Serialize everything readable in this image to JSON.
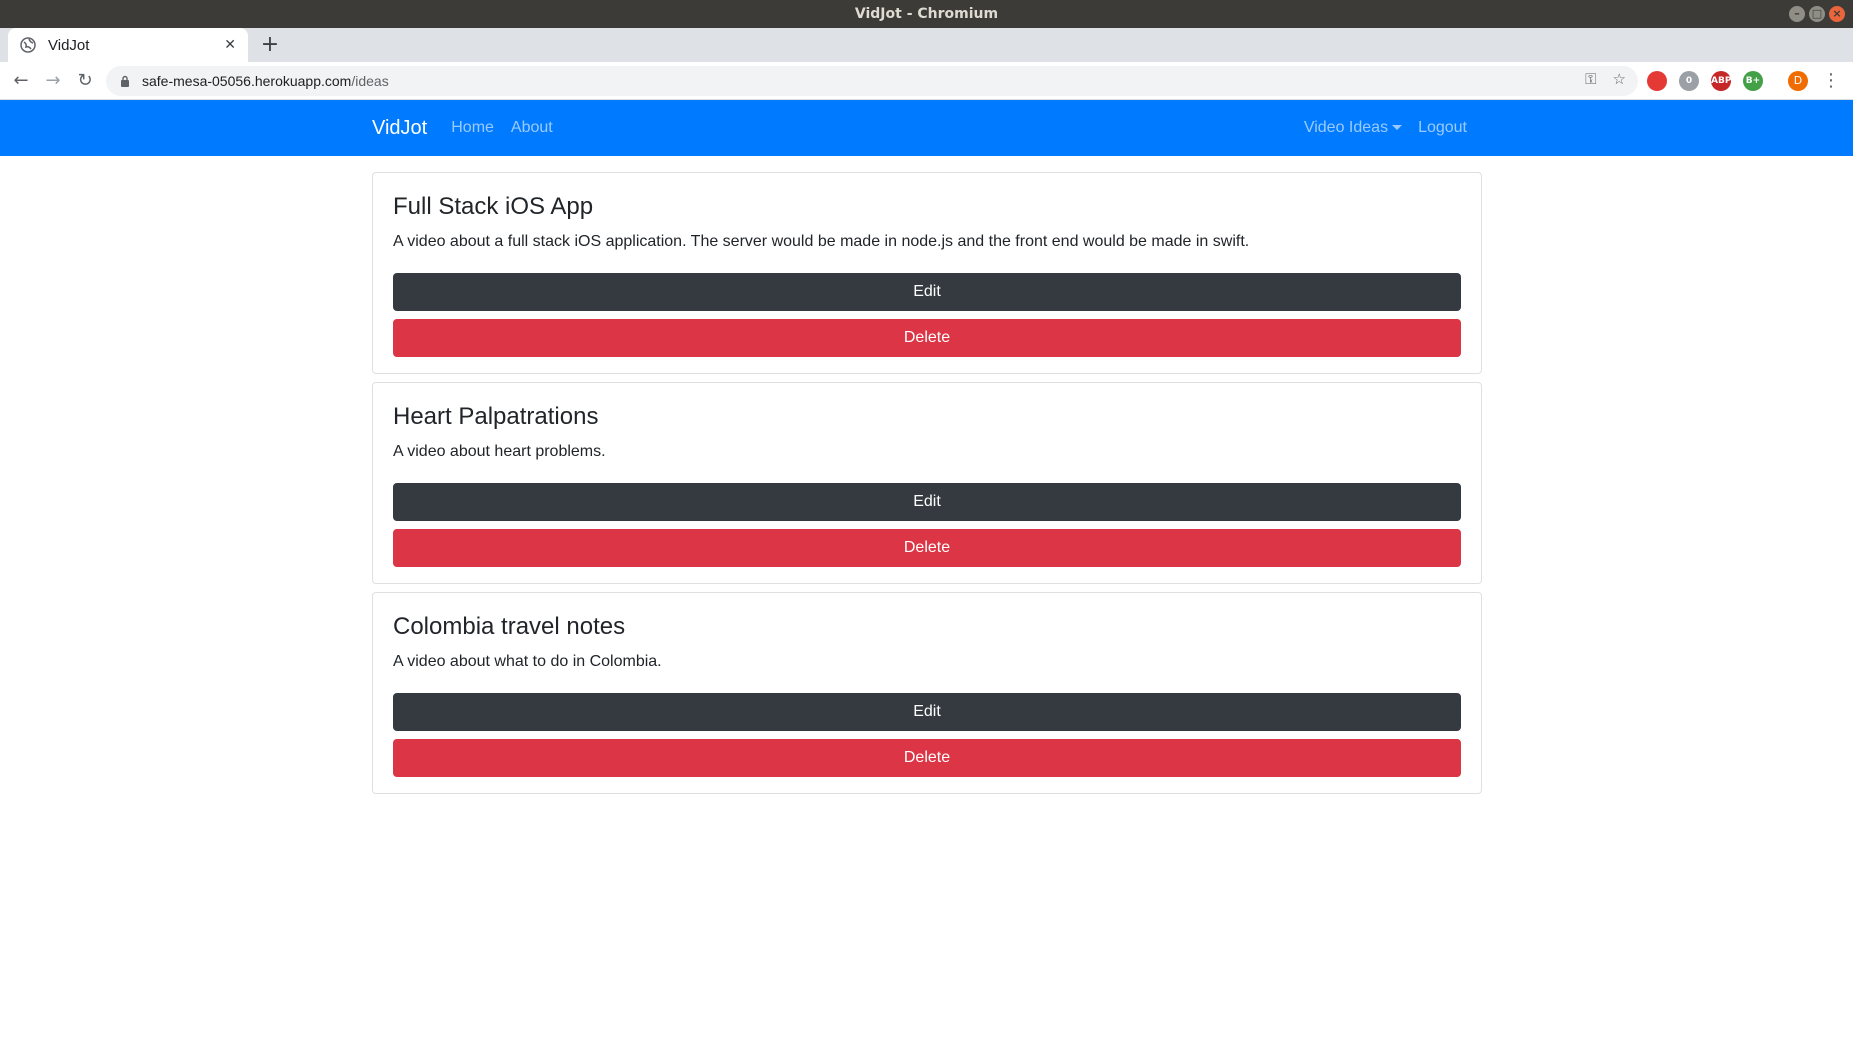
{
  "window": {
    "title": "VidJot - Chromium"
  },
  "browser": {
    "tab_title": "VidJot",
    "new_tab_label": "+",
    "url_host": "safe-mesa-05056.herokuapp.com",
    "url_path": "/ideas",
    "extensions": [
      {
        "name": "ublock-icon",
        "color": "#e53935",
        "label": ""
      },
      {
        "name": "privacy-extension-icon",
        "color": "#9aa0a6",
        "label": "0"
      },
      {
        "name": "adblock-plus-icon",
        "color": "#c62828",
        "label": "ABP"
      },
      {
        "name": "grammar-extension-icon",
        "color": "#43a047",
        "label": "B+"
      },
      {
        "name": "profile-avatar",
        "color": "#ef6c00",
        "label": "D"
      }
    ]
  },
  "navbar": {
    "brand": "VidJot",
    "links": [
      "Home",
      "About"
    ],
    "dropdown_label": "Video Ideas",
    "logout_label": "Logout",
    "background_color": "#007bff"
  },
  "ideas": [
    {
      "title": "Full Stack iOS App",
      "details": "A video about a full stack iOS application. The server would be made in node.js and the front end would be made in swift.",
      "edit_label": "Edit",
      "delete_label": "Delete"
    },
    {
      "title": "Heart Palpatrations",
      "details": "A video about heart problems.",
      "edit_label": "Edit",
      "delete_label": "Delete"
    },
    {
      "title": "Colombia travel notes",
      "details": "A video about what to do in Colombia.",
      "edit_label": "Edit",
      "delete_label": "Delete"
    }
  ],
  "colors": {
    "edit_button": "#343a40",
    "delete_button": "#dc3545"
  }
}
